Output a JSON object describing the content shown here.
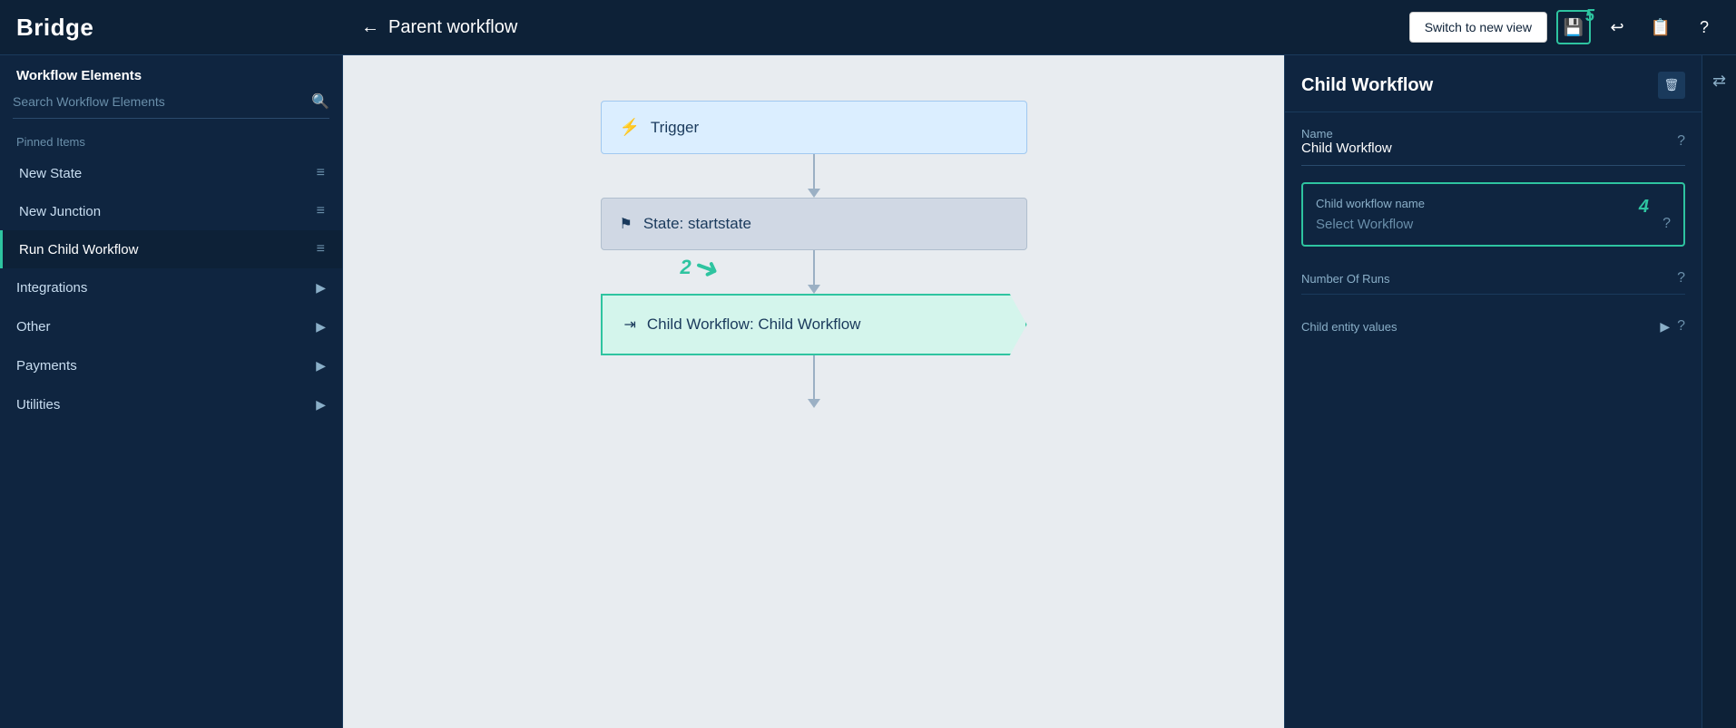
{
  "header": {
    "brand": "Bridge",
    "back_label": "←",
    "title": "Parent workflow",
    "switch_view_label": "Switch to new view",
    "save_icon": "💾",
    "undo_icon": "↩",
    "notes_icon": "📋",
    "help_icon": "?",
    "step5_badge": "5"
  },
  "sidebar": {
    "section_title": "Workflow Elements",
    "search_placeholder": "Search Workflow Elements",
    "pinned_label": "Pinned Items",
    "pinned_items": [
      {
        "id": "new-state",
        "label": "New State",
        "active": false
      },
      {
        "id": "new-junction",
        "label": "New Junction",
        "active": false
      },
      {
        "id": "run-child-workflow",
        "label": "Run Child Workflow",
        "active": true
      }
    ],
    "group_items": [
      {
        "id": "integrations",
        "label": "Integrations"
      },
      {
        "id": "other",
        "label": "Other"
      },
      {
        "id": "payments",
        "label": "Payments"
      },
      {
        "id": "utilities",
        "label": "Utilities"
      }
    ]
  },
  "canvas": {
    "nodes": [
      {
        "id": "trigger",
        "type": "trigger",
        "label": "Trigger",
        "icon": "⚡"
      },
      {
        "id": "startstate",
        "type": "state",
        "label": "State: startstate",
        "icon": "🏳"
      },
      {
        "id": "child-workflow",
        "type": "child",
        "label": "Child Workflow: Child Workflow",
        "icon": "⇥"
      }
    ],
    "step2_badge": "2"
  },
  "right_panel": {
    "title": "Child Workflow",
    "delete_icon": "🗑",
    "name_label": "Name",
    "name_value": "Child Workflow",
    "child_workflow_name_label": "Child workflow name",
    "child_workflow_value": "Select Workflow",
    "step4_badge": "4",
    "number_of_runs_label": "Number Of Runs",
    "child_entity_values_label": "Child entity values",
    "help_icon": "?"
  },
  "colors": {
    "accent": "#2ec4a0",
    "dark_bg": "#0d2137",
    "panel_bg": "#0f2540",
    "text_primary": "#ffffff",
    "text_secondary": "#8aafc8",
    "border": "#2a4a6c"
  }
}
